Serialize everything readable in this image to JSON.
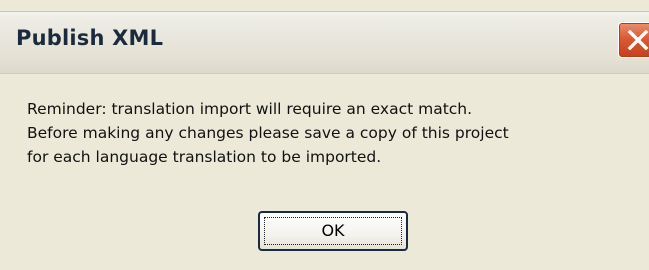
{
  "window": {
    "title": "Publish XML",
    "close_icon": "close-icon"
  },
  "message": {
    "lines": [
      "Reminder: translation import will require an exact match.",
      "Before making any changes please save a copy of this project",
      "for each language translation to be imported."
    ]
  },
  "buttons": {
    "ok_label": "OK"
  },
  "colors": {
    "dialog_background": "#ece9d8",
    "close_button": "#d95a35"
  }
}
